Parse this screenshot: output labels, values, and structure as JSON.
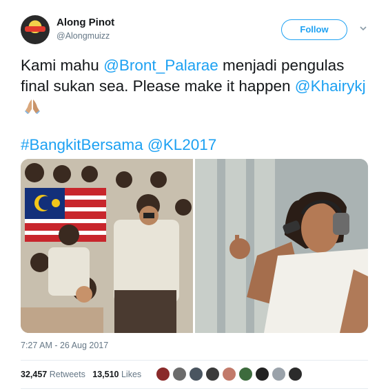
{
  "author": {
    "name": "Along Pinot",
    "handle": "@Alongmuizz",
    "avatar_icon": "user-avatar"
  },
  "follow": {
    "label": "Follow",
    "chevron_icon": "chevron-down-icon"
  },
  "tweet": {
    "line1_pre": "Kami mahu ",
    "mention1": "@Bront_Palarae",
    "line1_post": " menjadi pengulas final sukan sea. Please make it happen ",
    "mention2": "@Khairykj",
    "emoji_icon": "folded-hands-icon",
    "hashtag1": "#BangkitBersama",
    "mention3": "@KL2017"
  },
  "media": {
    "left_photo": "crowd-with-malaysian-flag-photo",
    "right_photo": "commentator-with-microphone-photo"
  },
  "meta": {
    "timestamp": "7:27 AM - 26 Aug 2017"
  },
  "stats": {
    "retweets_count": "32,457",
    "retweets_label": "Retweets",
    "likes_count": "13,510",
    "likes_label": "Likes"
  },
  "likers": {
    "colors": [
      "#8a2a2a",
      "#6b6b6b",
      "#4a5560",
      "#3a3a3a",
      "#c27a6a",
      "#3d6b3d",
      "#222222",
      "#9aa2aa",
      "#2b2b2b"
    ]
  }
}
